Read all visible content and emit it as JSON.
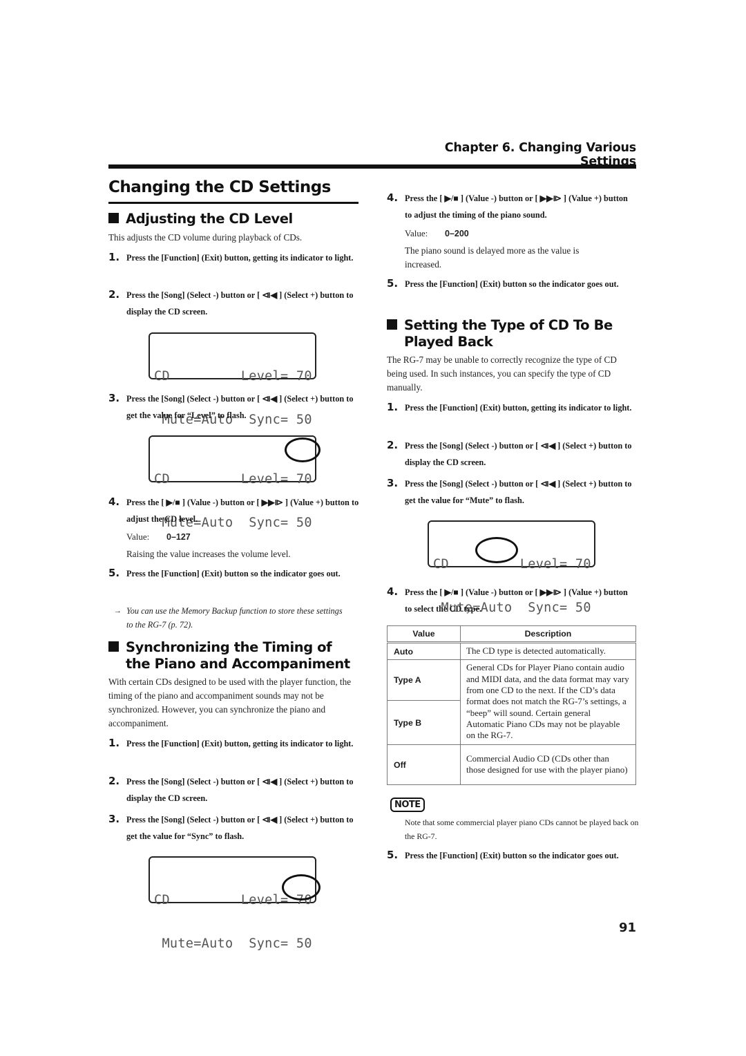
{
  "header": {
    "chapter": "Chapter 6. Changing Various Settings"
  },
  "page_title": "Changing the CD Settings",
  "lcd_screen": {
    "row1": "CD         Level= 70",
    "row2": " Mute=Auto  Sync= 50"
  },
  "sections": {
    "cd_level": {
      "heading": "Adjusting the CD Level",
      "intro": "This adjusts the CD volume during playback of CDs.",
      "steps": [
        {
          "num": "1.",
          "text": "Press the [Function] (Exit) button, getting its indicator to light."
        },
        {
          "num": "2.",
          "text": "Press the [Song] (Select -) button or [ ⧏◀ ] (Select +) button to display the CD screen."
        },
        {
          "num": "3.",
          "text": "Press the [Song] (Select -) button or [ ⧏◀ ] (Select +) button to get the value for “Level” to flash."
        },
        {
          "num": "4.",
          "text": "Press the [ ▶/■ ] (Value -) button or [ ▶▶⧐ ] (Value +) button to adjust the CD level."
        },
        {
          "num": "5.",
          "text": "Press the [Function] (Exit) button so the indicator goes out."
        }
      ],
      "value_label": "Value:",
      "value_range": "0–127",
      "value_note": "Raising the value increases the volume level.",
      "hint_arrow": "→",
      "hint": "You can use the Memory Backup function to store these settings to the RG-7 (p. 72)."
    },
    "sync": {
      "heading_line1": "Synchronizing the Timing of",
      "heading_line2": "the Piano and Accompaniment",
      "intro": "With certain CDs designed to be used with the player function, the timing of the piano and accompaniment sounds may not be synchronized. However, you can synchronize the piano and accompaniment.",
      "steps": [
        {
          "num": "1.",
          "text": "Press the [Function] (Exit) button, getting its indicator to light."
        },
        {
          "num": "2.",
          "text": "Press the [Song] (Select -) button or [ ⧏◀ ] (Select +) button to display the CD screen."
        },
        {
          "num": "3.",
          "text": "Press the [Song] (Select -) button or [ ⧏◀ ] (Select +) button to get the value for “Sync” to flash."
        },
        {
          "num": "4.",
          "text": "Press the [ ▶/■ ] (Value -) button or [ ▶▶⧐ ] (Value +) button to adjust the timing of the piano sound."
        },
        {
          "num": "5.",
          "text": "Press the [Function] (Exit) button so the indicator goes out."
        }
      ],
      "value_label": "Value:",
      "value_range": "0–200",
      "value_note": "The piano sound is delayed more as the value is increased."
    },
    "cd_type": {
      "heading_line1": "Setting the Type of CD To Be",
      "heading_line2": "Played Back",
      "intro": "The RG-7 may be unable to correctly recognize the type of CD being used. In such instances, you can specify the type of CD manually.",
      "steps": [
        {
          "num": "1.",
          "text": "Press the [Function] (Exit) button, getting its indicator to light."
        },
        {
          "num": "2.",
          "text": "Press the [Song] (Select -) button or [ ⧏◀ ] (Select +) button to display the CD screen."
        },
        {
          "num": "3.",
          "text": "Press the [Song] (Select -) button or [ ⧏◀ ] (Select +) button to get the value for “Mute” to flash."
        },
        {
          "num": "4.",
          "text": "Press the [ ▶/■ ] (Value -) button or [ ▶▶⧐ ] (Value +) button to select the CD type."
        },
        {
          "num": "5.",
          "text": "Press the [Function] (Exit) button so the indicator goes out."
        }
      ],
      "table": {
        "headers": [
          "Value",
          "Description"
        ],
        "rows": [
          {
            "value": "Auto",
            "description": "The CD type is detected automatically."
          },
          {
            "value": "Type A",
            "description": "General CDs for Player Piano contain audio and MIDI data, and the data format may vary from one CD to the next. If the CD’s data format does not match the RG-7’s settings, a “beep” will sound. Certain general Automatic Piano CDs may not be playable on the RG-7."
          },
          {
            "value": "Type B",
            "description": ""
          },
          {
            "value": "Off",
            "description": "Commercial Audio CD (CDs other than those designed for use with the player piano)"
          }
        ]
      },
      "note_label": "NOTE",
      "note": "Note that some commercial player piano CDs cannot be played back on the RG-7."
    }
  },
  "page_number": "91"
}
